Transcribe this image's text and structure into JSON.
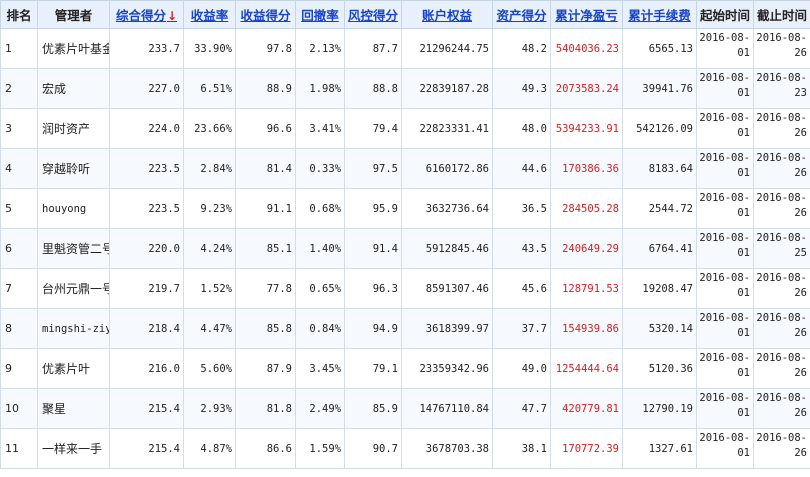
{
  "headers": {
    "rank": "排名",
    "manager": "管理者",
    "total_score": "综合得分",
    "sort_arrow": "↓",
    "return_rate": "收益率",
    "return_score": "收益得分",
    "drawdown": "回撤率",
    "risk_score": "风控得分",
    "equity": "账户权益",
    "asset_score": "资产得分",
    "cum_pnl": "累计净盈亏",
    "cum_fee": "累计手续费",
    "start_time": "起始时间",
    "end_time": "截止时间"
  },
  "colors": {
    "link": "#1a44c8",
    "profit_red": "#d21f1f",
    "sort_arrow": "#e02020",
    "header_bg": "#e8f1fb"
  },
  "rows": [
    {
      "rank": "1",
      "manager": "优素片叶基金",
      "score": "233.7",
      "ret": "33.90%",
      "ret_score": "97.8",
      "dd": "2.13%",
      "risk": "87.7",
      "equity": "21296244.75",
      "asset": "48.2",
      "pnl": "5404036.23",
      "fee": "6565.13",
      "start_a": "2016-08-",
      "start_b": "01",
      "end_a": "2016-08-",
      "end_b": "26"
    },
    {
      "rank": "2",
      "manager": "宏成",
      "score": "227.0",
      "ret": "6.51%",
      "ret_score": "88.9",
      "dd": "1.98%",
      "risk": "88.8",
      "equity": "22839187.28",
      "asset": "49.3",
      "pnl": "2073583.24",
      "fee": "39941.76",
      "start_a": "2016-08-",
      "start_b": "01",
      "end_a": "2016-08-",
      "end_b": "23"
    },
    {
      "rank": "3",
      "manager": "润时资产",
      "score": "224.0",
      "ret": "23.66%",
      "ret_score": "96.6",
      "dd": "3.41%",
      "risk": "79.4",
      "equity": "22823331.41",
      "asset": "48.0",
      "pnl": "5394233.91",
      "fee": "542126.09",
      "start_a": "2016-08-",
      "start_b": "01",
      "end_a": "2016-08-",
      "end_b": "26"
    },
    {
      "rank": "4",
      "manager": "穿越聆听",
      "score": "223.5",
      "ret": "2.84%",
      "ret_score": "81.4",
      "dd": "0.33%",
      "risk": "97.5",
      "equity": "6160172.86",
      "asset": "44.6",
      "pnl": "170386.36",
      "fee": "8183.64",
      "start_a": "2016-08-",
      "start_b": "01",
      "end_a": "2016-08-",
      "end_b": "26"
    },
    {
      "rank": "5",
      "manager": "houyong",
      "score": "223.5",
      "ret": "9.23%",
      "ret_score": "91.1",
      "dd": "0.68%",
      "risk": "95.9",
      "equity": "3632736.64",
      "asset": "36.5",
      "pnl": "284505.28",
      "fee": "2544.72",
      "start_a": "2016-08-",
      "start_b": "01",
      "end_a": "2016-08-",
      "end_b": "26",
      "mono": true
    },
    {
      "rank": "6",
      "manager": "里魁资管二号",
      "score": "220.0",
      "ret": "4.24%",
      "ret_score": "85.1",
      "dd": "1.40%",
      "risk": "91.4",
      "equity": "5912845.46",
      "asset": "43.5",
      "pnl": "240649.29",
      "fee": "6764.41",
      "start_a": "2016-08-",
      "start_b": "01",
      "end_a": "2016-08-",
      "end_b": "25"
    },
    {
      "rank": "7",
      "manager": "台州元鼎一号",
      "score": "219.7",
      "ret": "1.52%",
      "ret_score": "77.8",
      "dd": "0.65%",
      "risk": "96.3",
      "equity": "8591307.46",
      "asset": "45.6",
      "pnl": "128791.53",
      "fee": "19208.47",
      "start_a": "2016-08-",
      "start_b": "01",
      "end_a": "2016-08-",
      "end_b": "26"
    },
    {
      "rank": "8",
      "manager": "mingshi-ziyi",
      "score": "218.4",
      "ret": "4.47%",
      "ret_score": "85.8",
      "dd": "0.84%",
      "risk": "94.9",
      "equity": "3618399.97",
      "asset": "37.7",
      "pnl": "154939.86",
      "fee": "5320.14",
      "start_a": "2016-08-",
      "start_b": "01",
      "end_a": "2016-08-",
      "end_b": "26",
      "mono": true
    },
    {
      "rank": "9",
      "manager": "优素片叶",
      "score": "216.0",
      "ret": "5.60%",
      "ret_score": "87.9",
      "dd": "3.45%",
      "risk": "79.1",
      "equity": "23359342.96",
      "asset": "49.0",
      "pnl": "1254444.64",
      "fee": "5120.36",
      "start_a": "2016-08-",
      "start_b": "01",
      "end_a": "2016-08-",
      "end_b": "26"
    },
    {
      "rank": "10",
      "manager": "聚星",
      "score": "215.4",
      "ret": "2.93%",
      "ret_score": "81.8",
      "dd": "2.49%",
      "risk": "85.9",
      "equity": "14767110.84",
      "asset": "47.7",
      "pnl": "420779.81",
      "fee": "12790.19",
      "start_a": "2016-08-",
      "start_b": "01",
      "end_a": "2016-08-",
      "end_b": "26"
    },
    {
      "rank": "11",
      "manager": "一样来一手",
      "score": "215.4",
      "ret": "4.87%",
      "ret_score": "86.6",
      "dd": "1.59%",
      "risk": "90.7",
      "equity": "3678703.38",
      "asset": "38.1",
      "pnl": "170772.39",
      "fee": "1327.61",
      "start_a": "2016-08-",
      "start_b": "01",
      "end_a": "2016-08-",
      "end_b": "26"
    }
  ]
}
